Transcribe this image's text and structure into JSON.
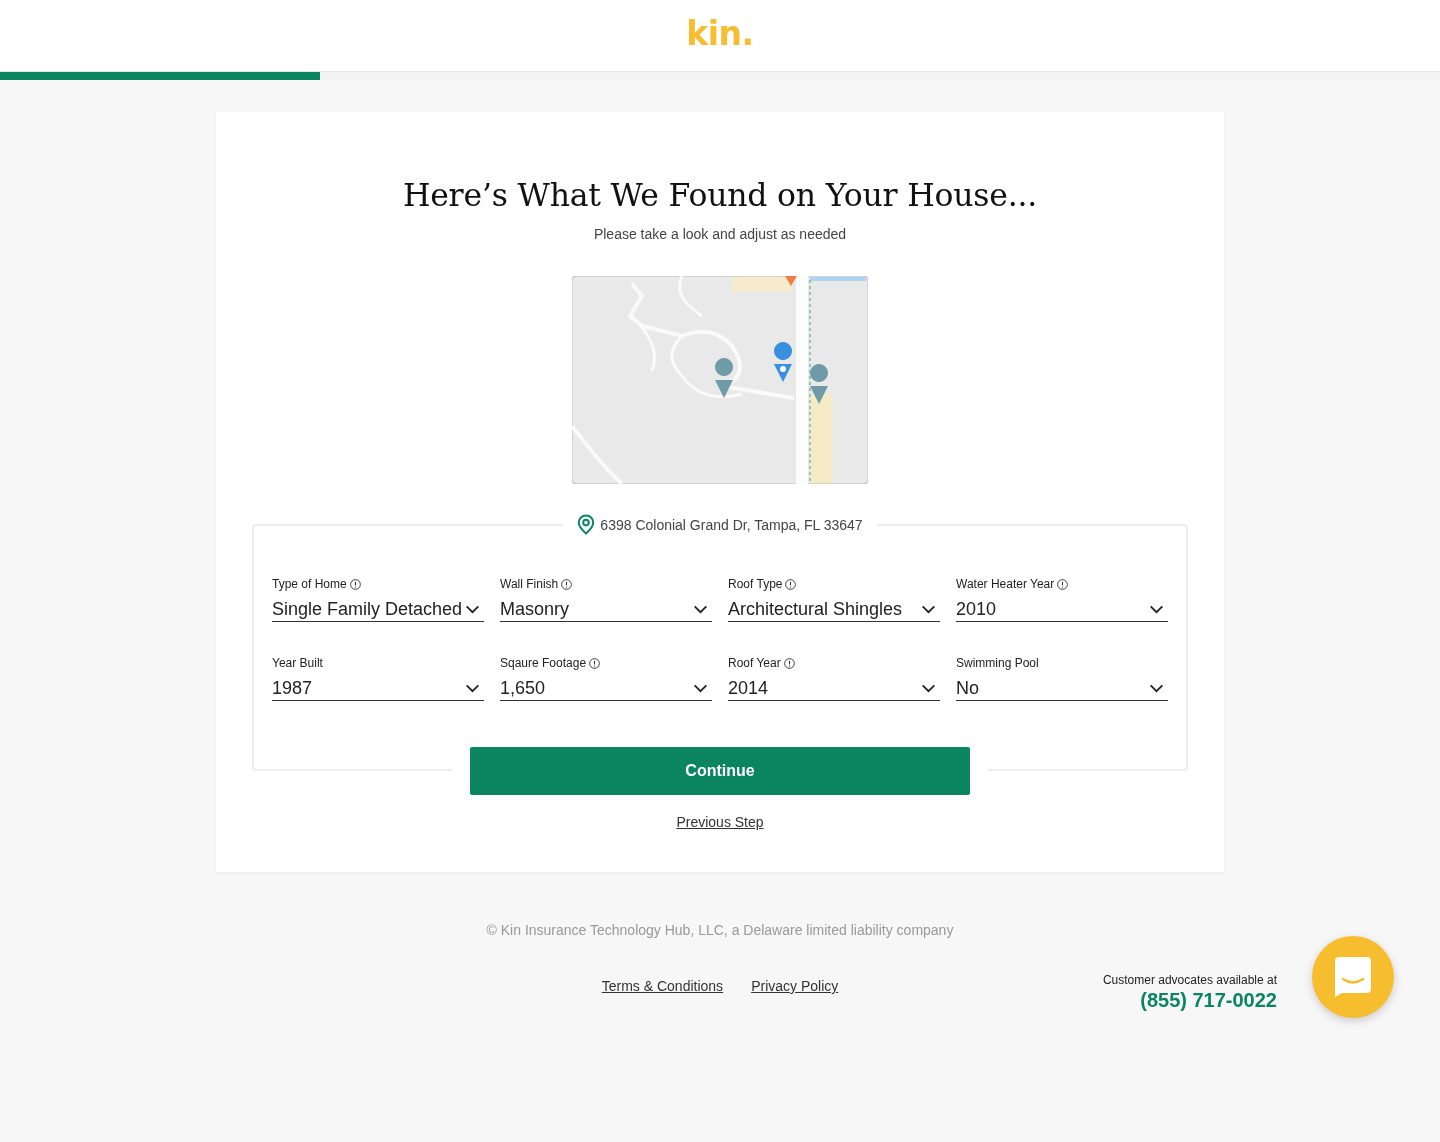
{
  "header": {
    "logo": "kin."
  },
  "progress": {
    "level": 0.222
  },
  "card": {
    "title": "Here’s What We Found on Your House...",
    "subtitle": "Please take a look and adjust as needed",
    "address": "6398 Colonial Grand Dr, Tampa, FL 33647",
    "fields": [
      {
        "label": "Type of Home",
        "info": true,
        "value": "Single Family Detached"
      },
      {
        "label": "Wall Finish",
        "info": true,
        "value": "Masonry"
      },
      {
        "label": "Roof Type",
        "info": true,
        "value": "Architectural Shingles"
      },
      {
        "label": "Water Heater Year",
        "info": true,
        "value": "2010"
      },
      {
        "label": "Year Built",
        "info": false,
        "value": "1987"
      },
      {
        "label": "Sqaure Footage",
        "info": true,
        "value": "1,650"
      },
      {
        "label": "Roof Year",
        "info": true,
        "value": "2014"
      },
      {
        "label": "Swimming Pool",
        "info": false,
        "value": "No"
      }
    ],
    "continue_button": "Continue",
    "previous_link": "Previous Step"
  },
  "footer": {
    "copyright": "© Kin Insurance Technology Hub, LLC, a Delaware limited liability company",
    "links": [
      "Terms & Conditions",
      "Privacy Policy"
    ],
    "advocates_text": "Customer advocates available at",
    "phone": "(855) 717-0022"
  }
}
